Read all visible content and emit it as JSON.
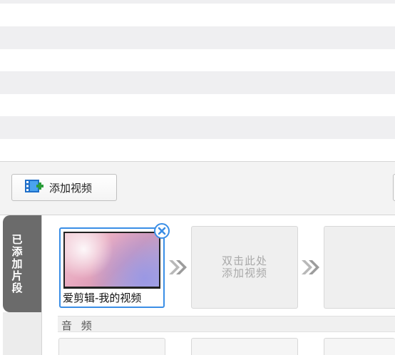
{
  "toolbar": {
    "add_video_label": "添加视频"
  },
  "side_tab": {
    "chars": [
      "已",
      "添",
      "加",
      "片",
      "段"
    ]
  },
  "clip": {
    "title": "爱剪辑-我的视频"
  },
  "empty_slot": {
    "line1": "双击此处",
    "line2": "添加视频"
  },
  "audio": {
    "label": "音 频"
  },
  "colors": {
    "accent": "#3a8ee6",
    "tab_bg": "#6b6b6b",
    "stripe": "#efeff1"
  },
  "icons": {
    "add_video": "film-add-icon",
    "close": "close-icon",
    "next": "double-chevron-right-icon"
  }
}
